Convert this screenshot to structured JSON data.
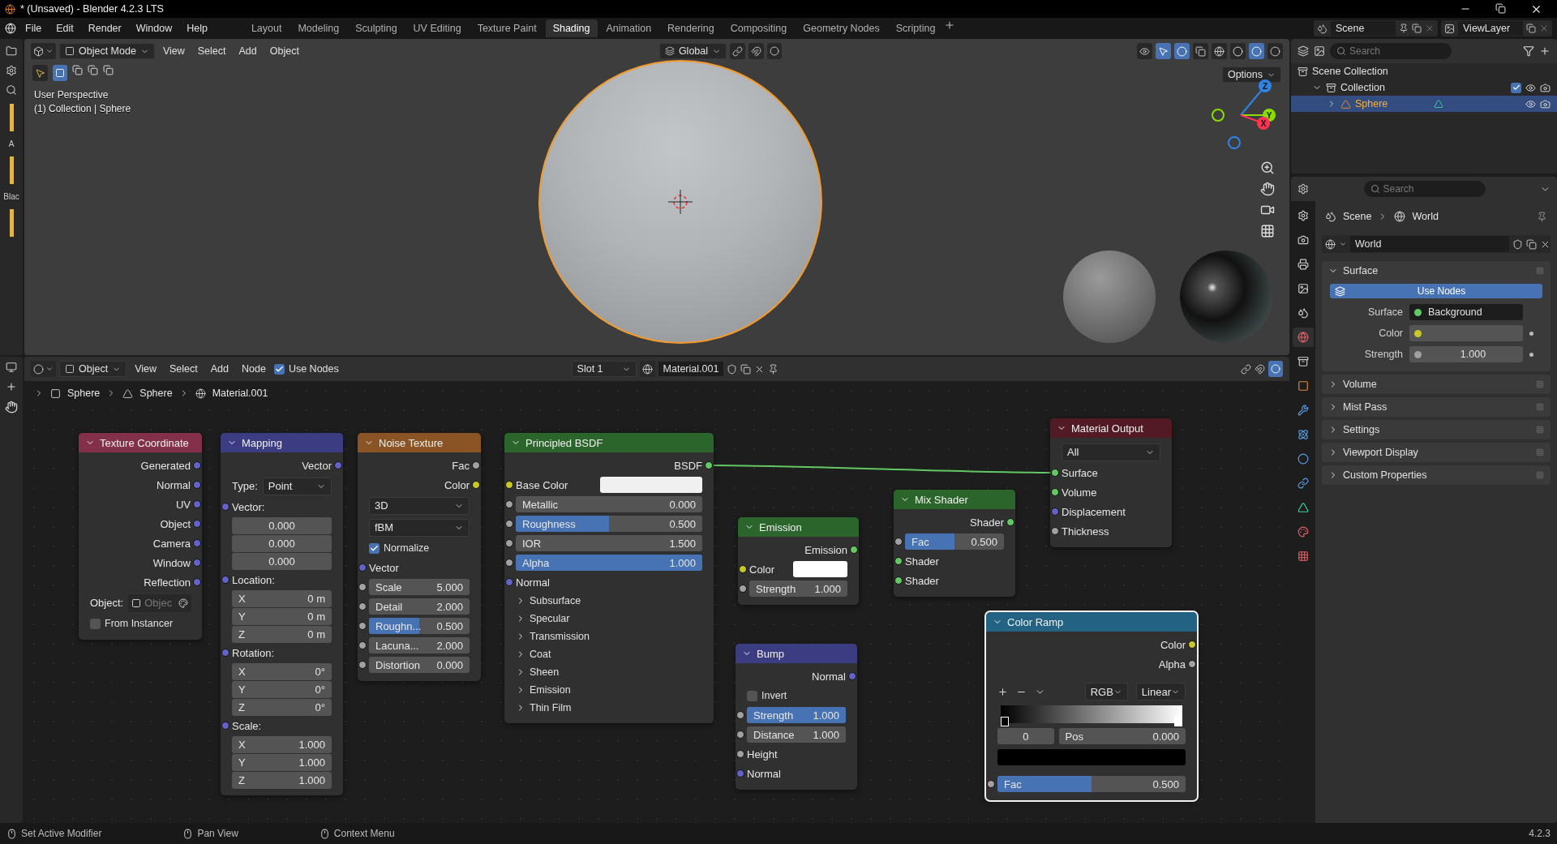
{
  "title_bar": {
    "title": "* (Unsaved) - Blender 4.2.3 LTS"
  },
  "menu": [
    "File",
    "Edit",
    "Render",
    "Window",
    "Help"
  ],
  "workspaces": [
    {
      "label": "Layout",
      "selected": false
    },
    {
      "label": "Modeling",
      "selected": false
    },
    {
      "label": "Sculpting",
      "selected": false
    },
    {
      "label": "UV Editing",
      "selected": false
    },
    {
      "label": "Texture Paint",
      "selected": false
    },
    {
      "label": "Shading",
      "selected": true
    },
    {
      "label": "Animation",
      "selected": false
    },
    {
      "label": "Rendering",
      "selected": false
    },
    {
      "label": "Compositing",
      "selected": false
    },
    {
      "label": "Geometry Nodes",
      "selected": false
    },
    {
      "label": "Scripting",
      "selected": false
    }
  ],
  "scene": {
    "name": "Scene"
  },
  "view_layer": {
    "name": "ViewLayer"
  },
  "side_editor": {
    "labels": [
      "A",
      "Blac"
    ]
  },
  "viewport": {
    "mode": "Object Mode",
    "menus": [
      "View",
      "Select",
      "Add",
      "Object"
    ],
    "orientation": "Global",
    "options": "Options",
    "overlay_lines": [
      "User Perspective",
      "(1) Collection | Sphere"
    ],
    "gizmo_axes": [
      {
        "label": "Z",
        "color": "#2f83e3"
      },
      {
        "label": "Y",
        "color": "#8bdc00"
      },
      {
        "label": "X",
        "color": "#ff3352"
      }
    ]
  },
  "node_editor": {
    "object_mode": "Object",
    "menus": [
      "View",
      "Select",
      "Add",
      "Node"
    ],
    "use_nodes": {
      "label": "Use Nodes",
      "checked": true
    },
    "slot": "Slot 1",
    "material": "Material.001",
    "breadcrumb": [
      "Sphere",
      "Sphere",
      "Material.001"
    ],
    "nodes": [
      {
        "title": "Texture Coordinate",
        "color": "#83314a",
        "selected": false,
        "rows": [
          {
            "kind": "output",
            "label": "Generated",
            "color": "#6363c7"
          },
          {
            "kind": "output",
            "label": "Normal",
            "color": "#6363c7"
          },
          {
            "kind": "output",
            "label": "UV",
            "color": "#6363c7"
          },
          {
            "kind": "output",
            "label": "Object",
            "color": "#6363c7"
          },
          {
            "kind": "output",
            "label": "Camera",
            "color": "#6363c7"
          },
          {
            "kind": "output",
            "label": "Window",
            "color": "#6363c7"
          },
          {
            "kind": "output",
            "label": "Reflection",
            "color": "#6363c7"
          },
          {
            "kind": "object",
            "label": "Object:",
            "placeholder": "Objec"
          },
          {
            "kind": "checkbox",
            "label": "From Instancer",
            "checked": false
          }
        ]
      },
      {
        "title": "Mapping",
        "color": "#3c3c83",
        "selected": false,
        "rows": [
          {
            "kind": "output",
            "label": "Vector",
            "color": "#6363c7"
          },
          {
            "kind": "dropdown",
            "label": "Type:",
            "value": "Point"
          },
          {
            "kind": "label",
            "label": "Vector:",
            "color": "#6363c7"
          },
          {
            "kind": "vector",
            "value": "0.000"
          },
          {
            "kind": "vector",
            "value": "0.000"
          },
          {
            "kind": "vector",
            "value": "0.000"
          },
          {
            "kind": "label",
            "label": "Location:",
            "color": "#6363c7"
          },
          {
            "kind": "vector",
            "label": "X",
            "value": "0 m"
          },
          {
            "kind": "vector",
            "label": "Y",
            "value": "0 m"
          },
          {
            "kind": "vector",
            "label": "Z",
            "value": "0 m"
          },
          {
            "kind": "label",
            "label": "Rotation:",
            "color": "#6363c7"
          },
          {
            "kind": "vector",
            "label": "X",
            "value": "0°"
          },
          {
            "kind": "vector",
            "label": "Y",
            "value": "0°"
          },
          {
            "kind": "vector",
            "label": "Z",
            "value": "0°"
          },
          {
            "kind": "label",
            "label": "Scale:",
            "color": "#6363c7"
          },
          {
            "kind": "vector",
            "label": "X",
            "value": "1.000"
          },
          {
            "kind": "vector",
            "label": "Y",
            "value": "1.000"
          },
          {
            "kind": "vector",
            "label": "Z",
            "value": "1.000"
          }
        ]
      },
      {
        "title": "Noise Texture",
        "color": "#8a5424",
        "selected": false,
        "rows": [
          {
            "kind": "output",
            "label": "Fac",
            "color": "#a1a1a1"
          },
          {
            "kind": "output",
            "label": "Color",
            "color": "#c7c729"
          },
          {
            "kind": "dropdown",
            "value": "3D"
          },
          {
            "kind": "dropdown",
            "value": "fBM"
          },
          {
            "kind": "checkbox",
            "label": "Normalize",
            "checked": true
          },
          {
            "kind": "input",
            "label": "Vector",
            "color": "#6363c7"
          },
          {
            "kind": "number",
            "label": "Scale",
            "value": "5.000",
            "color": "#a1a1a1"
          },
          {
            "kind": "number",
            "label": "Detail",
            "value": "2.000",
            "color": "#a1a1a1"
          },
          {
            "kind": "number",
            "label": "Roughn...",
            "value": "0.500",
            "level": 0.5,
            "color": "#a1a1a1"
          },
          {
            "kind": "number",
            "label": "Lacuna...",
            "value": "2.000",
            "color": "#a1a1a1"
          },
          {
            "kind": "number",
            "label": "Distortion",
            "value": "0.000",
            "color": "#a1a1a1"
          }
        ]
      },
      {
        "title": "Principled BSDF",
        "color": "#2b652b",
        "selected": false,
        "rows": [
          {
            "kind": "output",
            "label": "BSDF",
            "color": "#63c763",
            "linked": true
          },
          {
            "kind": "color",
            "label": "Base Color",
            "swatch": {
              "color": "#f0f0f0"
            },
            "color": "#c7c729"
          },
          {
            "kind": "number",
            "label": "Metallic",
            "value": "0.000",
            "color": "#a1a1a1"
          },
          {
            "kind": "number",
            "label": "Roughness",
            "value": "0.500",
            "level": 0.5,
            "color": "#a1a1a1"
          },
          {
            "kind": "number",
            "label": "IOR",
            "value": "1.500",
            "color": "#a1a1a1"
          },
          {
            "kind": "number",
            "label": "Alpha",
            "value": "1.000",
            "level": 1,
            "color": "#a1a1a1"
          },
          {
            "kind": "input",
            "label": "Normal",
            "color": "#6363c7"
          },
          {
            "kind": "panel",
            "label": "Subsurface",
            "expanded": false
          },
          {
            "kind": "panel",
            "label": "Specular",
            "expanded": false
          },
          {
            "kind": "panel",
            "label": "Transmission",
            "expanded": false
          },
          {
            "kind": "panel",
            "label": "Coat",
            "expanded": false
          },
          {
            "kind": "panel",
            "label": "Sheen",
            "expanded": false
          },
          {
            "kind": "panel",
            "label": "Emission",
            "expanded": false
          },
          {
            "kind": "panel",
            "label": "Thin Film",
            "expanded": false
          }
        ]
      },
      {
        "title": "Emission",
        "color": "#2b652b",
        "selected": false,
        "rows": [
          {
            "kind": "output",
            "label": "Emission",
            "color": "#63c763"
          },
          {
            "kind": "color",
            "label": "Color",
            "swatch": {
              "color": "#ffffff"
            },
            "color": "#c7c729"
          },
          {
            "kind": "number",
            "label": "Strength",
            "value": "1.000",
            "color": "#a1a1a1"
          }
        ]
      },
      {
        "title": "Bump",
        "color": "#3c3c83",
        "selected": false,
        "rows": [
          {
            "kind": "output",
            "label": "Normal",
            "color": "#6363c7"
          },
          {
            "kind": "checkbox",
            "label": "Invert",
            "checked": false
          },
          {
            "kind": "number",
            "label": "Strength",
            "value": "1.000",
            "level": 1,
            "color": "#a1a1a1"
          },
          {
            "kind": "number",
            "label": "Distance",
            "value": "1.000",
            "color": "#a1a1a1"
          },
          {
            "kind": "input",
            "label": "Height",
            "color": "#a1a1a1"
          },
          {
            "kind": "input",
            "label": "Normal",
            "color": "#6363c7"
          }
        ]
      },
      {
        "title": "Mix Shader",
        "color": "#2b652b",
        "selected": false,
        "rows": [
          {
            "kind": "output",
            "label": "Shader",
            "color": "#63c763"
          },
          {
            "kind": "number",
            "label": "Fac",
            "value": "0.500",
            "level": 0.5,
            "color": "#a1a1a1"
          },
          {
            "kind": "input",
            "label": "Shader",
            "color": "#63c763"
          },
          {
            "kind": "input",
            "label": "Shader",
            "color": "#63c763"
          }
        ]
      },
      {
        "title": "Material Output",
        "color": "#521a25",
        "selected": false,
        "rows": [
          {
            "kind": "dropdown",
            "value": "All"
          },
          {
            "kind": "input",
            "label": "Surface",
            "color": "#63c763",
            "linked": true
          },
          {
            "kind": "input",
            "label": "Volume",
            "color": "#63c763"
          },
          {
            "kind": "input",
            "label": "Displacement",
            "color": "#6363c7"
          },
          {
            "kind": "input",
            "label": "Thickness",
            "color": "#a1a1a1"
          }
        ]
      },
      {
        "title": "Color Ramp",
        "color": "#246283",
        "selected": true,
        "rows": [
          {
            "kind": "output",
            "label": "Color",
            "color": "#c7c729"
          },
          {
            "kind": "output",
            "label": "Alpha",
            "color": "#a1a1a1"
          },
          {
            "kind": "ramp",
            "color_mode": "RGB",
            "interpolation": "Linear",
            "stop_index": "0",
            "pos_label": "Pos",
            "pos_value": "0.000",
            "stop": {
              "color": "#000000"
            }
          },
          {
            "kind": "number",
            "label": "Fac",
            "value": "0.500",
            "level": 0.5,
            "color": "#a1a1a1"
          }
        ]
      }
    ]
  },
  "outliner": {
    "search_placeholder": "Search",
    "tree": [
      {
        "label": "Scene Collection",
        "selected": false,
        "children": [
          {
            "label": "Collection",
            "selected": false,
            "expanded": true,
            "checked": true,
            "children": [
              {
                "label": "Sphere",
                "selected": true,
                "expanded": false
              }
            ]
          }
        ]
      }
    ]
  },
  "properties": {
    "search_placeholder": "Search",
    "tabs": [
      {
        "kind": "tool",
        "selected": false
      },
      {
        "kind": "render",
        "selected": false
      },
      {
        "kind": "output",
        "selected": false
      },
      {
        "kind": "view_layer",
        "selected": false
      },
      {
        "kind": "scene",
        "selected": false
      },
      {
        "kind": "world",
        "selected": true
      },
      {
        "kind": "collection",
        "selected": false
      },
      {
        "kind": "object",
        "selected": false
      },
      {
        "kind": "modifier",
        "selected": false
      },
      {
        "kind": "particles",
        "selected": false
      },
      {
        "kind": "physics",
        "selected": false
      },
      {
        "kind": "constraints",
        "selected": false
      },
      {
        "kind": "data",
        "selected": false
      },
      {
        "kind": "material",
        "selected": false
      },
      {
        "kind": "texture",
        "selected": false
      }
    ],
    "breadcrumb": [
      "Scene",
      "World"
    ],
    "datablock": "World",
    "panels": [
      {
        "label": "Surface",
        "expanded": true,
        "button": "Use Nodes",
        "fields": [
          {
            "label": "Surface",
            "value": "Background",
            "color": "#63c763"
          },
          {
            "label": "Color",
            "color": "#c7c729"
          },
          {
            "label": "Strength",
            "value": "1.000",
            "color": "#a1a1a1"
          }
        ]
      },
      {
        "label": "Volume",
        "expanded": false
      },
      {
        "label": "Mist Pass",
        "expanded": false
      },
      {
        "label": "Settings",
        "expanded": false
      },
      {
        "label": "Viewport Display",
        "expanded": false
      },
      {
        "label": "Custom Properties",
        "expanded": false
      }
    ]
  },
  "status_bar": {
    "hints": [
      "Set Active Modifier",
      "Pan View",
      "Context Menu"
    ],
    "version": "4.2.3"
  }
}
